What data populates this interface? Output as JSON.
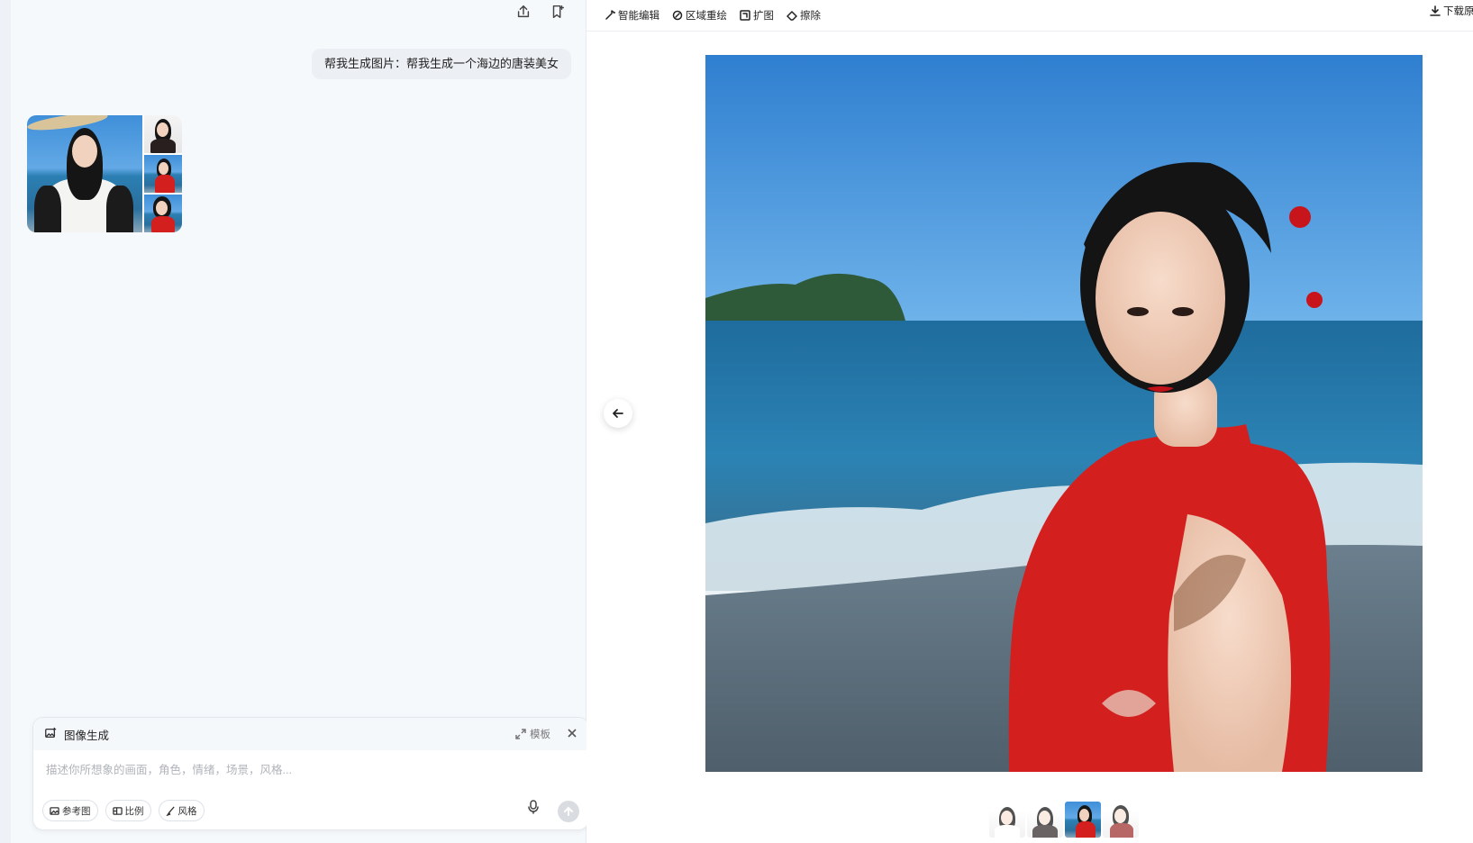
{
  "chat": {
    "user_message": "帮我生成图片：帮我生成一个海边的唐装美女"
  },
  "composer": {
    "mode_label": "图像生成",
    "template_label": "模板",
    "placeholder": "描述你所想象的画面，角色，情绪，场景，风格...",
    "chips": {
      "reference": "参考图",
      "ratio": "比例",
      "style": "风格"
    }
  },
  "toolbar": {
    "smart_edit": "智能编辑",
    "region_redraw": "区域重绘",
    "expand": "扩图",
    "erase": "擦除",
    "download": "下载原图"
  },
  "icons": {
    "share": "share-icon",
    "bookmark": "bookmark-icon",
    "back": "arrow-left-icon",
    "mic": "microphone-icon",
    "send": "arrow-up-icon"
  },
  "colors": {
    "dress": "#d41f1f",
    "sky": "#3f8fd9",
    "sea": "#2a7fae"
  }
}
